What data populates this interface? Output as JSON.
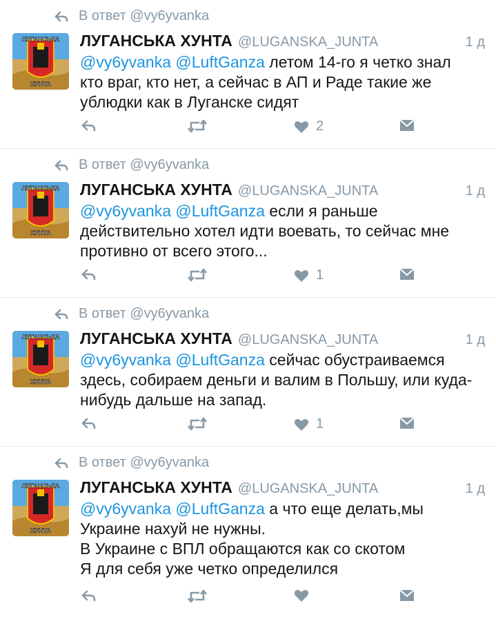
{
  "colors": {
    "accent": "#1b95e0",
    "muted": "#8899a6",
    "text": "#14171a",
    "divider": "#e1e8ed"
  },
  "icons": {
    "reply_context": "reply-arrow-icon",
    "reply": "reply-icon",
    "retweet": "retweet-icon",
    "like": "heart-icon",
    "dm": "direct-message-icon",
    "avatar": "luganska-junta-emblem"
  },
  "tweets": [
    {
      "reply_context": "В ответ @vy6yvanka",
      "name": "ЛУГАНСЬКА ХУНТА",
      "handle": "@LUGANSKA_JUNTA",
      "time": "1 д",
      "mention1": "@vy6yvanka",
      "mention2": "@LuftGanza",
      "text": "летом 14-го я четко знал кто враг, кто нет, а сейчас в АП и Раде такие же ублюдки как в Луганске сидят",
      "likes": "2"
    },
    {
      "reply_context": "В ответ @vy6yvanka",
      "name": "ЛУГАНСЬКА ХУНТА",
      "handle": "@LUGANSKA_JUNTA",
      "time": "1 д",
      "mention1": "@vy6yvanka",
      "mention2": "@LuftGanza",
      "text": "если я раньше действительно хотел идти воевать, то сейчас мне противно от всего этого...",
      "likes": "1"
    },
    {
      "reply_context": "В ответ @vy6yvanka",
      "name": "ЛУГАНСЬКА ХУНТА",
      "handle": "@LUGANSKA_JUNTA",
      "time": "1 д",
      "mention1": "@vy6yvanka",
      "mention2": "@LuftGanza",
      "text": "сейчас обустраиваемся здесь, собираем деньги и валим в Польшу, или куда-нибудь дальше на запад.",
      "likes": "1"
    },
    {
      "reply_context": "В ответ @vy6yvanka",
      "name": "ЛУГАНСЬКА ХУНТА",
      "handle": "@LUGANSKA_JUNTA",
      "time": "1 д",
      "mention1": "@vy6yvanka",
      "mention2": "@LuftGanza",
      "text": "а что еще делать,мы Украине нахуй не нужны.\nВ Украине с ВПЛ обращаются как со скотом\nЯ для себя уже четко определился",
      "likes": ""
    }
  ]
}
